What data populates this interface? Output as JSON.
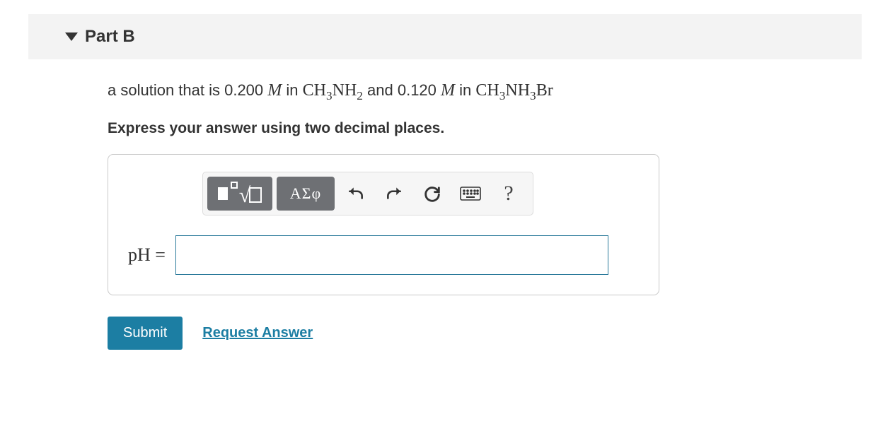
{
  "part": {
    "title": "Part B"
  },
  "question": {
    "pre1": "a solution that is 0.200 ",
    "m": "M",
    "in1": " in ",
    "chem1_html": "CH<sub>3</sub>NH<sub>2</sub>",
    "mid": " and 0.120 ",
    "in2": " in ",
    "chem2_html": "CH<sub>3</sub>NH<sub>3</sub>Br"
  },
  "instruction": "Express your answer using two decimal places.",
  "toolbar": {
    "greek_label": "ΑΣφ",
    "help_label": "?"
  },
  "answer": {
    "lhs": "pH",
    "eq": "=",
    "value": ""
  },
  "actions": {
    "submit": "Submit",
    "request": "Request Answer"
  }
}
